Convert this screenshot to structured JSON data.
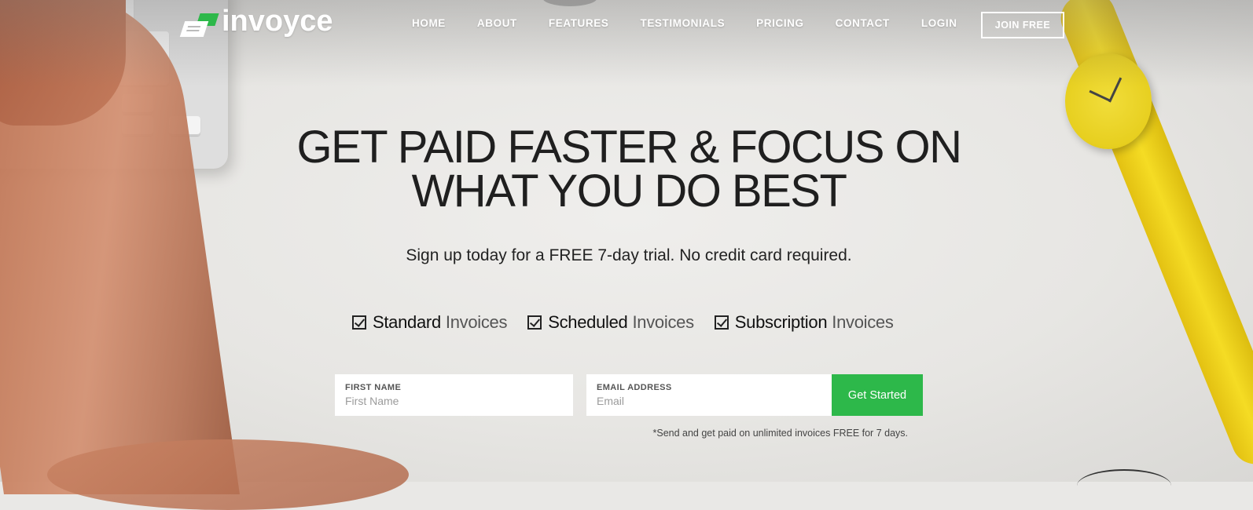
{
  "brand": {
    "name": "invoyce"
  },
  "nav": {
    "items": [
      "HOME",
      "ABOUT",
      "FEATURES",
      "TESTIMONIALS",
      "PRICING",
      "CONTACT",
      "LOGIN"
    ],
    "cta_label": "JOIN FREE"
  },
  "hero": {
    "headline_line1": "GET PAID FASTER & FOCUS ON",
    "headline_line2": "WHAT YOU DO BEST",
    "subline": "Sign up today for a FREE 7-day trial. No credit card required."
  },
  "features": [
    {
      "strong": "Standard",
      "light": "Invoices",
      "checked": true
    },
    {
      "strong": "Scheduled",
      "light": "Invoices",
      "checked": true
    },
    {
      "strong": "Subscription",
      "light": "Invoices",
      "checked": true
    }
  ],
  "form": {
    "first_name_label": "FIRST NAME",
    "first_name_placeholder": "First Name",
    "email_label": "EMAIL ADDRESS",
    "email_placeholder": "Email",
    "submit_label": "Get Started",
    "note": "*Send and get paid on unlimited invoices FREE for 7 days."
  },
  "colors": {
    "accent": "#2db84a",
    "text": "#1f1f1f",
    "nav_text": "#ffffff"
  }
}
